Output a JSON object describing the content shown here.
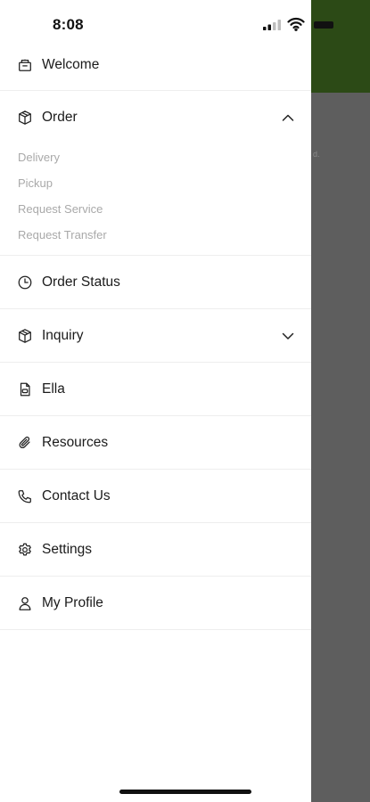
{
  "status_bar": {
    "time": "8:08"
  },
  "background": {
    "partial_text": "d."
  },
  "menu": {
    "welcome": {
      "label": "Welcome",
      "icon": "store-icon"
    },
    "order": {
      "label": "Order",
      "icon": "package-icon",
      "expanded": true,
      "subitems": [
        "Delivery",
        "Pickup",
        "Request Service",
        "Request Transfer"
      ]
    },
    "order_status": {
      "label": "Order Status",
      "icon": "clock-icon"
    },
    "inquiry": {
      "label": "Inquiry",
      "icon": "package-icon",
      "expanded": false
    },
    "ella": {
      "label": "Ella",
      "icon": "chat-document-icon"
    },
    "resources": {
      "label": "Resources",
      "icon": "paperclip-icon"
    },
    "contact_us": {
      "label": "Contact Us",
      "icon": "phone-icon"
    },
    "settings": {
      "label": "Settings",
      "icon": "gear-icon"
    },
    "my_profile": {
      "label": "My Profile",
      "icon": "user-icon"
    }
  },
  "colors": {
    "header_green": "#2c4a16",
    "overlay_gray": "#5e5e5e",
    "submenu_text": "#a9a9a9"
  }
}
